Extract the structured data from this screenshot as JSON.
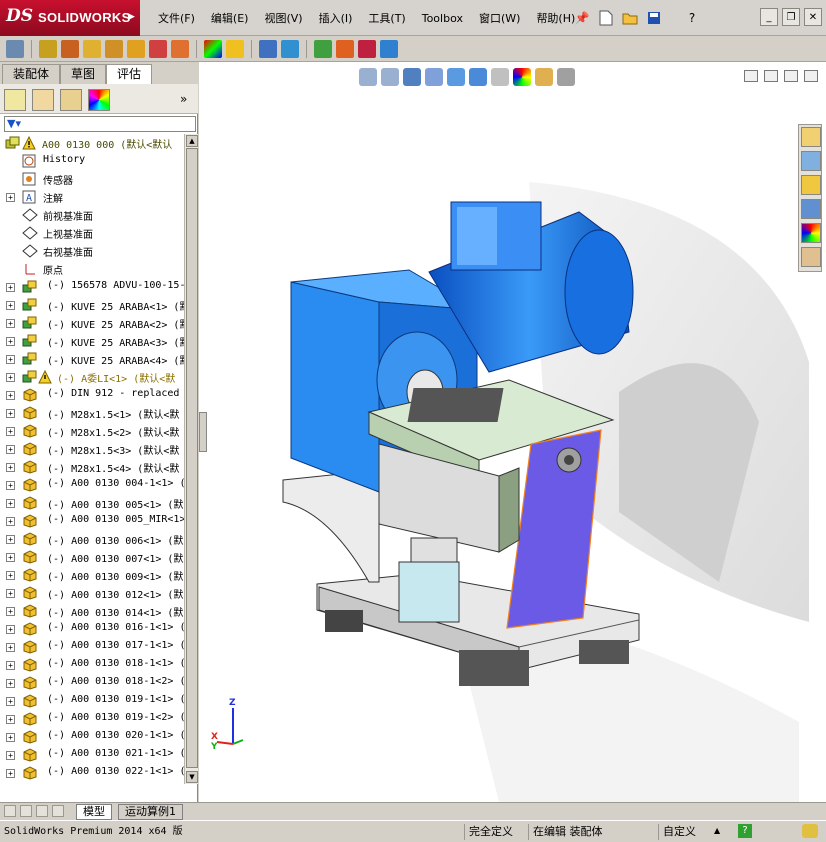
{
  "app": {
    "logo_ds": "DS",
    "logo_text": "SOLIDWORKS"
  },
  "menu": [
    "文件(F)",
    "编辑(E)",
    "视图(V)",
    "插入(I)",
    "工具(T)",
    "Toolbox",
    "窗口(W)",
    "帮助(H)"
  ],
  "panel": {
    "tabs": [
      "装配体",
      "草图",
      "评估"
    ],
    "active_tab": "评估"
  },
  "tree": {
    "root": "A00 0130 000 (默认<默认",
    "items": [
      {
        "label": "History",
        "icon": "history-icon",
        "kind": "folder"
      },
      {
        "label": "传感器",
        "icon": "sensor-icon",
        "kind": "folder"
      },
      {
        "label": "注解",
        "icon": "annotation-icon",
        "kind": "folder",
        "expandable": true
      },
      {
        "label": "前视基准面",
        "icon": "plane-icon",
        "kind": "plane"
      },
      {
        "label": "上视基准面",
        "icon": "plane-icon",
        "kind": "plane"
      },
      {
        "label": "右视基准面",
        "icon": "plane-icon",
        "kind": "plane"
      },
      {
        "label": "原点",
        "icon": "origin-icon",
        "kind": "origin"
      },
      {
        "label": "(-) 156578 ADVU-100-15-",
        "icon": "assembly-icon",
        "kind": "asm"
      },
      {
        "label": "(-) KUVE 25 ARABA<1> (默",
        "icon": "assembly-icon",
        "kind": "asm"
      },
      {
        "label": "(-) KUVE 25 ARABA<2> (默",
        "icon": "assembly-icon",
        "kind": "asm"
      },
      {
        "label": "(-) KUVE 25 ARABA<3> (默",
        "icon": "assembly-icon",
        "kind": "asm"
      },
      {
        "label": "(-) KUVE 25 ARABA<4> (默",
        "icon": "assembly-icon",
        "kind": "asm"
      },
      {
        "label": "(-) A委LI<1> (默认<默",
        "icon": "assembly-icon",
        "kind": "asm-warn"
      },
      {
        "label": "(-) DIN 912 - replaced",
        "icon": "part-icon",
        "kind": "part"
      },
      {
        "label": "(-) M28x1.5<1> (默认<默",
        "icon": "part-icon",
        "kind": "part"
      },
      {
        "label": "(-) M28x1.5<2> (默认<默",
        "icon": "part-icon",
        "kind": "part"
      },
      {
        "label": "(-) M28x1.5<3> (默认<默",
        "icon": "part-icon",
        "kind": "part"
      },
      {
        "label": "(-) M28x1.5<4> (默认<默",
        "icon": "part-icon",
        "kind": "part"
      },
      {
        "label": "(-) A00 0130 004-1<1> (",
        "icon": "part-icon",
        "kind": "part"
      },
      {
        "label": "(-) A00 0130 005<1> (默",
        "icon": "part-icon",
        "kind": "part"
      },
      {
        "label": "(-) A00 0130 005_MIR<1>",
        "icon": "part-icon",
        "kind": "part"
      },
      {
        "label": "(-) A00 0130 006<1> (默",
        "icon": "part-icon",
        "kind": "part"
      },
      {
        "label": "(-) A00 0130 007<1> (默",
        "icon": "part-icon",
        "kind": "part"
      },
      {
        "label": "(-) A00 0130 009<1> (默",
        "icon": "part-icon",
        "kind": "part"
      },
      {
        "label": "(-) A00 0130 012<1> (默",
        "icon": "part-icon",
        "kind": "part"
      },
      {
        "label": "(-) A00 0130 014<1> (默",
        "icon": "part-icon",
        "kind": "part"
      },
      {
        "label": "(-) A00 0130 016-1<1> (",
        "icon": "part-icon",
        "kind": "part"
      },
      {
        "label": "(-) A00 0130 017-1<1> (",
        "icon": "part-icon",
        "kind": "part"
      },
      {
        "label": "(-) A00 0130 018-1<1> (",
        "icon": "part-icon",
        "kind": "part"
      },
      {
        "label": "(-) A00 0130 018-1<2> (",
        "icon": "part-icon",
        "kind": "part"
      },
      {
        "label": "(-) A00 0130 019-1<1> (",
        "icon": "part-icon",
        "kind": "part"
      },
      {
        "label": "(-) A00 0130 019-1<2> (",
        "icon": "part-icon",
        "kind": "part"
      },
      {
        "label": "(-) A00 0130 020-1<1> (",
        "icon": "part-icon",
        "kind": "part"
      },
      {
        "label": "(-) A00 0130 021-1<1> (",
        "icon": "part-icon",
        "kind": "part"
      },
      {
        "label": "(-) A00 0130 022-1<1> (",
        "icon": "part-icon",
        "kind": "part"
      }
    ]
  },
  "bottom_tabs": [
    "模型",
    "运动算例1"
  ],
  "status": {
    "version": "SolidWorks Premium 2014 x64 版",
    "defined": "完全定义",
    "editing": "在编辑 装配体",
    "units": "自定义"
  },
  "triad": {
    "x": "X",
    "y": "Y",
    "z": "Z"
  },
  "colors": {
    "accent_blue": "#1e6fe8",
    "part_blue": "#2a8cf0",
    "purple_plate": "#6a5ae6",
    "light_green": "#cfe8c8",
    "orange_edge": "#f08020"
  }
}
